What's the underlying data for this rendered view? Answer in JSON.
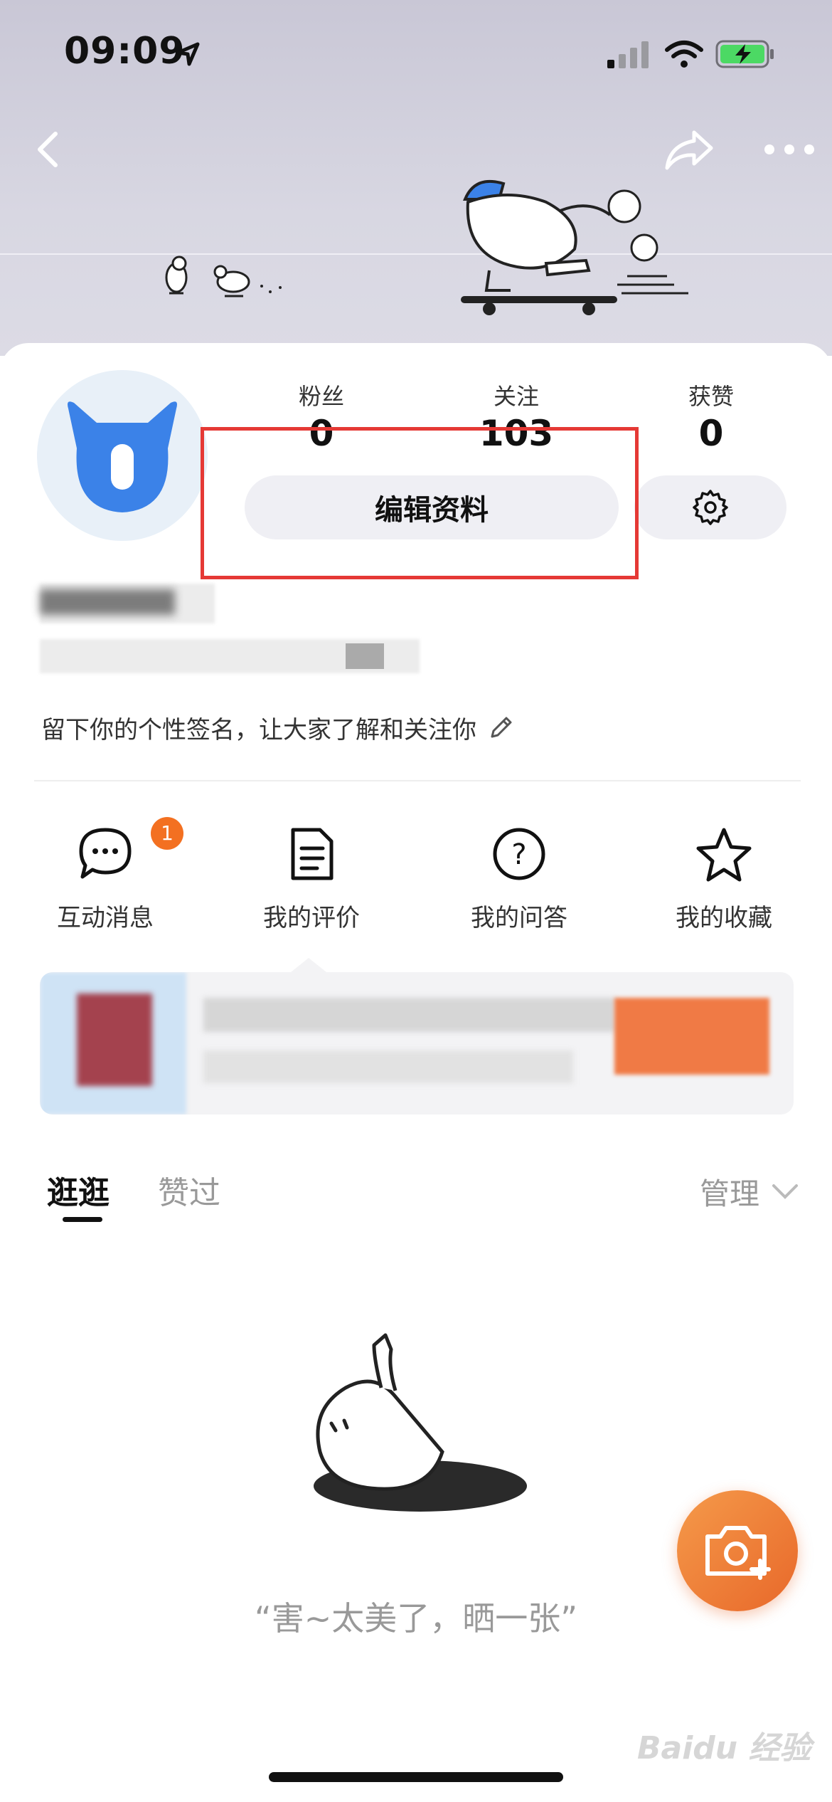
{
  "status_bar": {
    "time": "09:09"
  },
  "profile": {
    "stats": [
      {
        "label": "粉丝",
        "value": "0"
      },
      {
        "label": "关注",
        "value": "103"
      },
      {
        "label": "获赞",
        "value": "0"
      }
    ],
    "edit_button_label": "编辑资料",
    "signature": "留下你的个性签名，让大家了解和关注你"
  },
  "actions": [
    {
      "label": "互动消息",
      "icon": "chat-bubble-icon",
      "badge": "1"
    },
    {
      "label": "我的评价",
      "icon": "document-icon"
    },
    {
      "label": "我的问答",
      "icon": "question-icon"
    },
    {
      "label": "我的收藏",
      "icon": "star-icon"
    }
  ],
  "tabs": [
    {
      "label": "逛逛",
      "active": true
    },
    {
      "label": "赞过",
      "active": false
    }
  ],
  "manage_label": "管理",
  "empty_state": {
    "text": "“害~太美了，晒一张”"
  },
  "watermark": "Baidu 经验",
  "colors": {
    "accent": "#f37021",
    "highlight": "#e53935",
    "avatar_blue": "#3b82e8"
  }
}
